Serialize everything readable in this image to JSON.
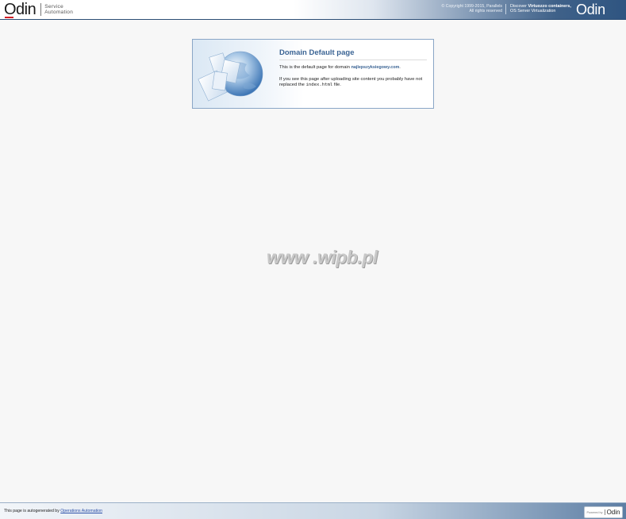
{
  "header": {
    "logo_left": "Odin",
    "logo_left_sub1": "Service",
    "logo_left_sub2": "Automation",
    "copyright_line1": "© Copyright 1999-2015, Parallels",
    "copyright_line2": "All rights reserved",
    "discover_prefix": "Discover ",
    "discover_bold": "Virtuozzo containers,",
    "discover_line2": "OS Server Virtualization",
    "logo_right": "Odin"
  },
  "card": {
    "title": "Domain Default page",
    "line1_prefix": "This is the default page for domain ",
    "domain": "najlepszyksiegowy.com",
    "line1_suffix": ".",
    "line2_prefix": "If you see this page after uploading site content you probably have not replaced the ",
    "line2_code": "index.html",
    "line2_suffix": " file."
  },
  "watermark": "www .wipb.pl",
  "footer": {
    "prefix": "This page is autogenerated by ",
    "link": "Operations Automation",
    "powered_by": "Powered by",
    "powered_logo": "Odin"
  },
  "colors": {
    "accent": "#3b6494",
    "header_dark": "#2f5581",
    "logo_red": "#d31f26"
  }
}
